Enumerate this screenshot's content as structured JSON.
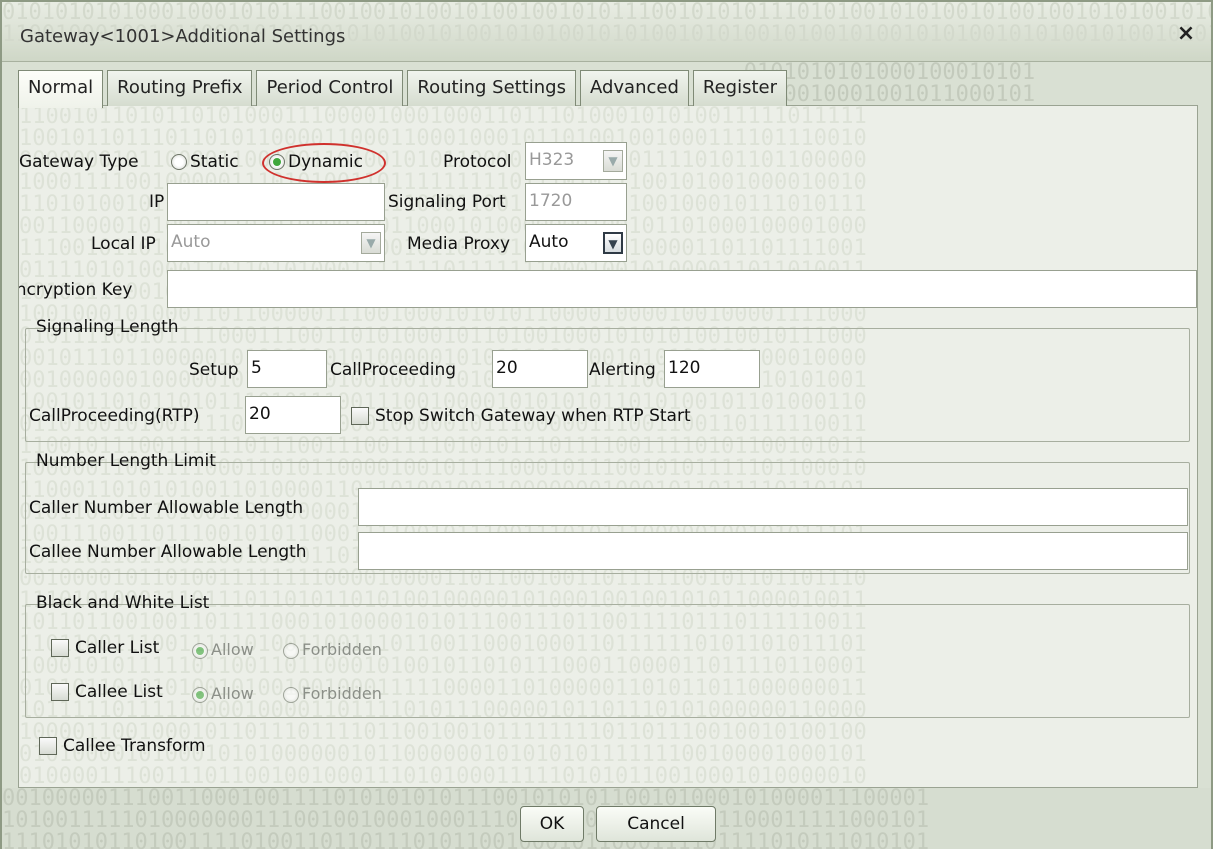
{
  "window": {
    "title": "Gateway<1001>Additional Settings",
    "close_label": "×"
  },
  "tabs": [
    {
      "label": "Normal",
      "active": true
    },
    {
      "label": "Routing Prefix",
      "active": false
    },
    {
      "label": "Period Control",
      "active": false
    },
    {
      "label": "Routing Settings",
      "active": false
    },
    {
      "label": "Advanced",
      "active": false
    },
    {
      "label": "Register",
      "active": false
    }
  ],
  "normal": {
    "gateway_type_label": "Gateway Type",
    "static_label": "Static",
    "dynamic_label": "Dynamic",
    "gateway_type_value": "Dynamic",
    "protocol_label": "Protocol",
    "protocol_value": "H323",
    "ip_label": "IP",
    "ip_value": "",
    "signaling_port_label": "Signaling Port",
    "signaling_port_value": "1720",
    "local_ip_label": "Local IP",
    "local_ip_value": "Auto",
    "media_proxy_label": "Media Proxy",
    "media_proxy_value": "Auto",
    "encryption_key_label": "Encryption Key",
    "encryption_key_value": ""
  },
  "signaling_length": {
    "title": "Signaling Length",
    "setup_label": "Setup",
    "setup_value": "5",
    "callproceeding_label": "CallProceeding",
    "callproceeding_value": "20",
    "alerting_label": "Alerting",
    "alerting_value": "120",
    "callproceeding_rtp_label": "CallProceeding(RTP)",
    "callproceeding_rtp_value": "20",
    "stop_switch_label": "Stop Switch Gateway when RTP Start",
    "stop_switch_checked": false
  },
  "number_length": {
    "title": "Number Length Limit",
    "caller_label": "Caller Number Allowable Length",
    "caller_value": "",
    "callee_label": "Callee Number Allowable Length",
    "callee_value": ""
  },
  "black_white": {
    "title": "Black and White List",
    "caller_list_label": "Caller List",
    "callee_list_label": "Callee List",
    "allow_label": "Allow",
    "forbidden_label": "Forbidden",
    "caller_list_checked": false,
    "callee_list_checked": false,
    "caller_mode": "Allow",
    "callee_mode": "Allow"
  },
  "callee_transform": {
    "label": "Callee Transform",
    "checked": false
  },
  "buttons": {
    "ok": "OK",
    "cancel": "Cancel"
  },
  "colors": {
    "highlight_circle": "#d0312d",
    "radio_checked": "#3fa73b"
  }
}
